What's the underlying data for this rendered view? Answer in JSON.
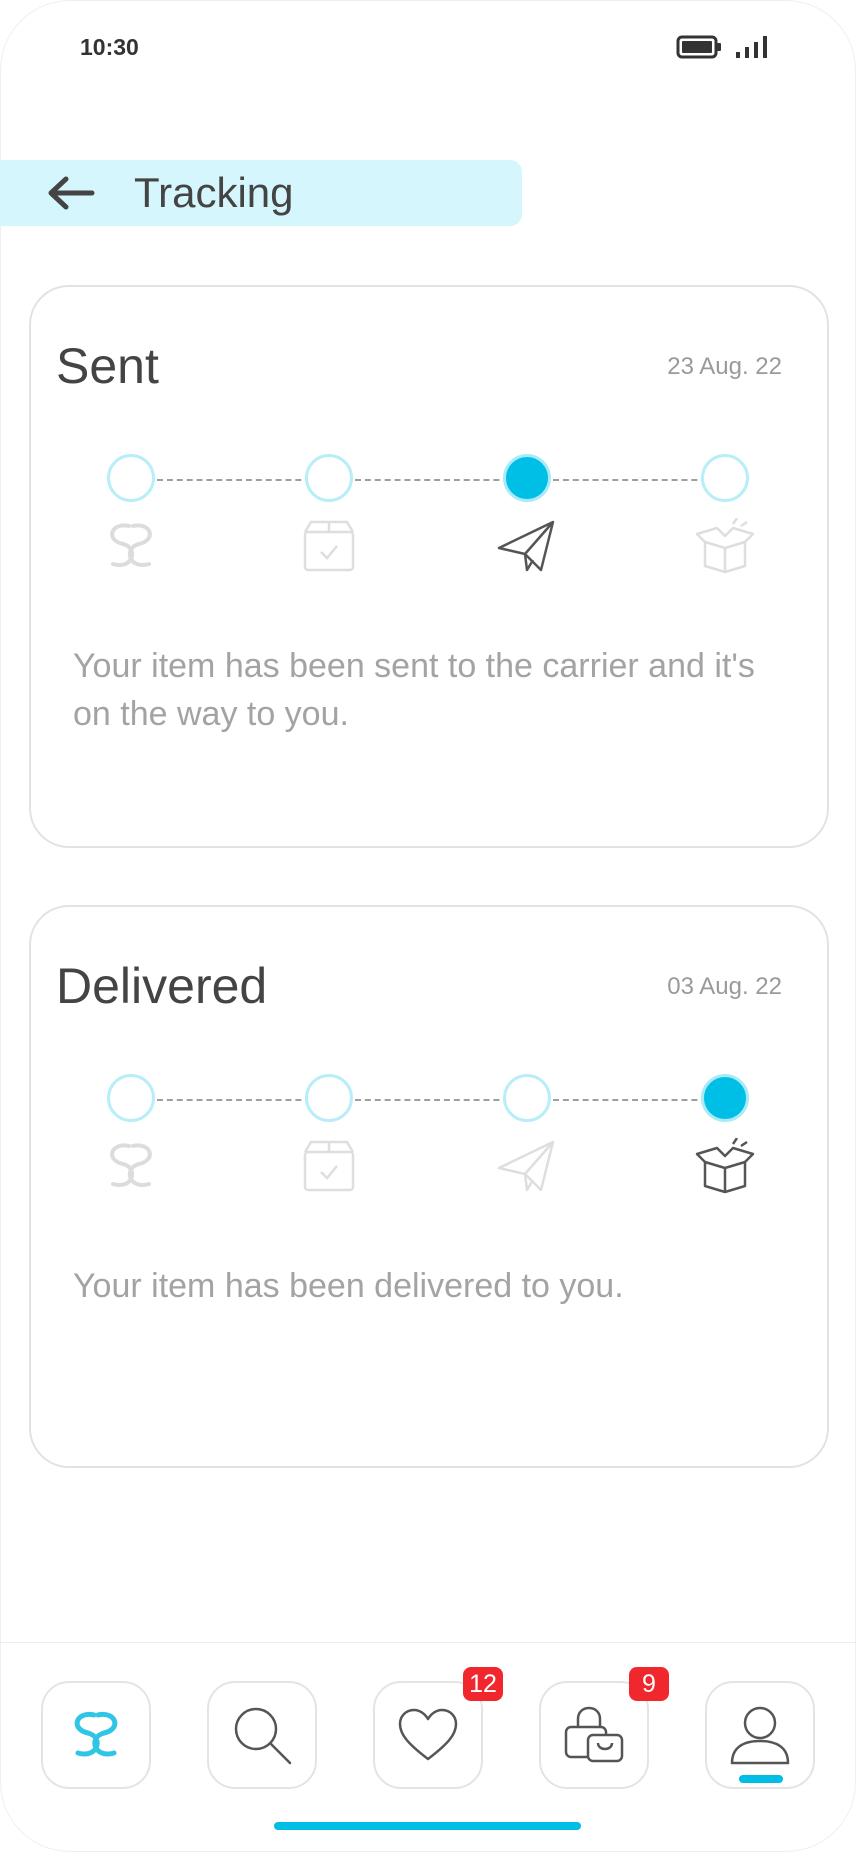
{
  "status_bar": {
    "time": "10:30"
  },
  "header": {
    "title": "Tracking"
  },
  "cards": [
    {
      "title": "Sent",
      "date": "23 Aug. 22",
      "message": "Your item has been sent to the carrier and it's on the way to you.",
      "active_step": 3
    },
    {
      "title": "Delivered",
      "date": "03 Aug. 22",
      "message": "Your item has been delivered to you.",
      "active_step": 4
    }
  ],
  "steps": [
    "logo-icon",
    "box-check-icon",
    "paper-plane-icon",
    "open-box-icon"
  ],
  "bottom_nav": {
    "items": [
      "home-logo-icon",
      "search-icon",
      "heart-icon",
      "shopping-bag-icon",
      "profile-icon"
    ],
    "favorites_badge": "12",
    "bag_badge": "9",
    "active_item": "profile-icon"
  },
  "colors": {
    "accent": "#00bfe6",
    "header_bg": "#d4f6fc",
    "badge": "#f0282e"
  }
}
